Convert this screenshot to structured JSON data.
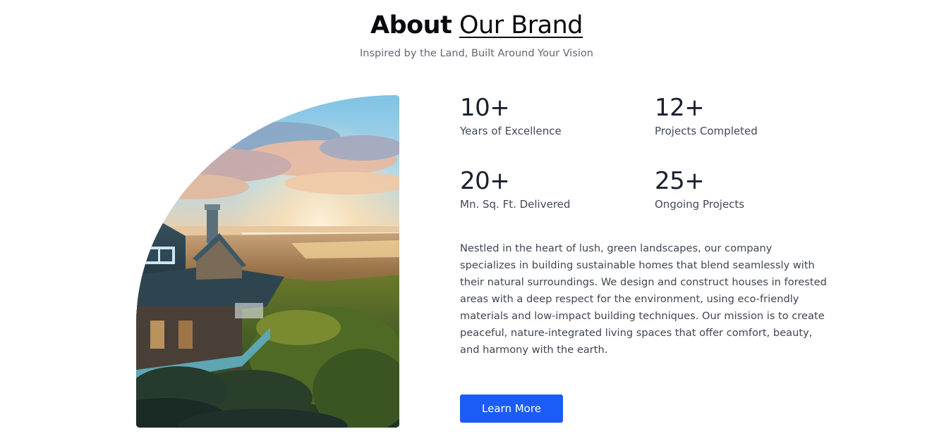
{
  "header": {
    "title_bold": "About",
    "title_light": "Our Brand",
    "subtitle": "Inspired by the Land, Built Around Your Vision"
  },
  "stats": [
    {
      "value": "10+",
      "label": "Years of Excellence"
    },
    {
      "value": "12+",
      "label": "Projects Completed"
    },
    {
      "value": "20+",
      "label": "Mn. Sq. Ft. Delivered"
    },
    {
      "value": "25+",
      "label": "Ongoing Projects"
    }
  ],
  "description": "Nestled in the heart of lush, green landscapes, our company specializes in building sustainable homes that blend seamlessly with their natural surroundings. We design and construct houses in forested areas with a deep respect for the environment, using eco-friendly materials and low-impact building techniques. Our mission is to create peaceful, nature-integrated living spaces that offer comfort, beauty, and harmony with the earth.",
  "cta": {
    "label": "Learn More"
  },
  "colors": {
    "accent": "#1c5cf6",
    "heading": "#0b0b0f",
    "body_text": "#3f4652",
    "muted_text": "#606774"
  }
}
